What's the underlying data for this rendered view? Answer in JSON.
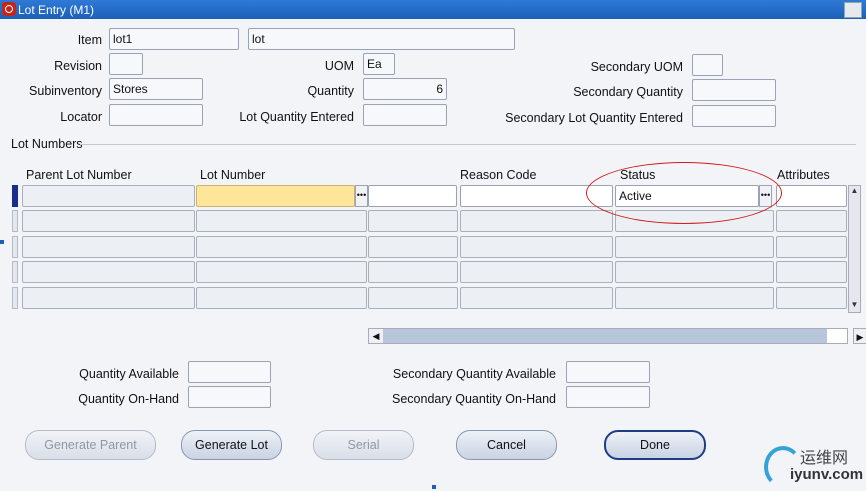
{
  "window": {
    "title": "Lot Entry (M1)"
  },
  "header": {
    "item_label": "Item",
    "item_value": "lot1",
    "item_desc": "lot",
    "revision_label": "Revision",
    "revision_value": "",
    "uom_label": "UOM",
    "uom_value": "Ea",
    "secondary_uom_label": "Secondary UOM",
    "secondary_uom_value": "",
    "subinventory_label": "Subinventory",
    "subinventory_value": "Stores",
    "quantity_label": "Quantity",
    "quantity_value": "6",
    "secondary_quantity_label": "Secondary Quantity",
    "secondary_quantity_value": "",
    "locator_label": "Locator",
    "locator_value": "",
    "lot_qty_entered_label": "Lot Quantity Entered",
    "lot_qty_entered_value": "",
    "secondary_lot_qty_entered_label": "Secondary Lot Quantity Entered",
    "secondary_lot_qty_entered_value": ""
  },
  "lot_numbers": {
    "section_title": "Lot Numbers",
    "columns": {
      "parent_lot": "Parent Lot Number",
      "lot_number": "Lot Number",
      "reason_code": "Reason Code",
      "status": "Status",
      "attributes": "Attributes"
    },
    "rows": [
      {
        "parent_lot": "",
        "lot_number": "",
        "reason_code": "",
        "status": "Active",
        "attributes": ""
      }
    ]
  },
  "summary": {
    "qty_available_label": "Quantity Available",
    "qty_available_value": "",
    "qty_onhand_label": "Quantity On-Hand",
    "qty_onhand_value": "",
    "sec_qty_available_label": "Secondary Quantity Available",
    "sec_qty_available_value": "",
    "sec_qty_onhand_label": "Secondary Quantity On-Hand",
    "sec_qty_onhand_value": ""
  },
  "buttons": {
    "generate_parent": "Generate Parent",
    "generate_lot": "Generate Lot",
    "serial": "Serial",
    "cancel": "Cancel",
    "done": "Done"
  },
  "watermark": {
    "cn": "运维网",
    "en": "iyunv.com"
  },
  "colors": {
    "title_bar": "#1b5fb8",
    "highlight_field": "#fde59a",
    "annotation": "#d21b1b"
  }
}
